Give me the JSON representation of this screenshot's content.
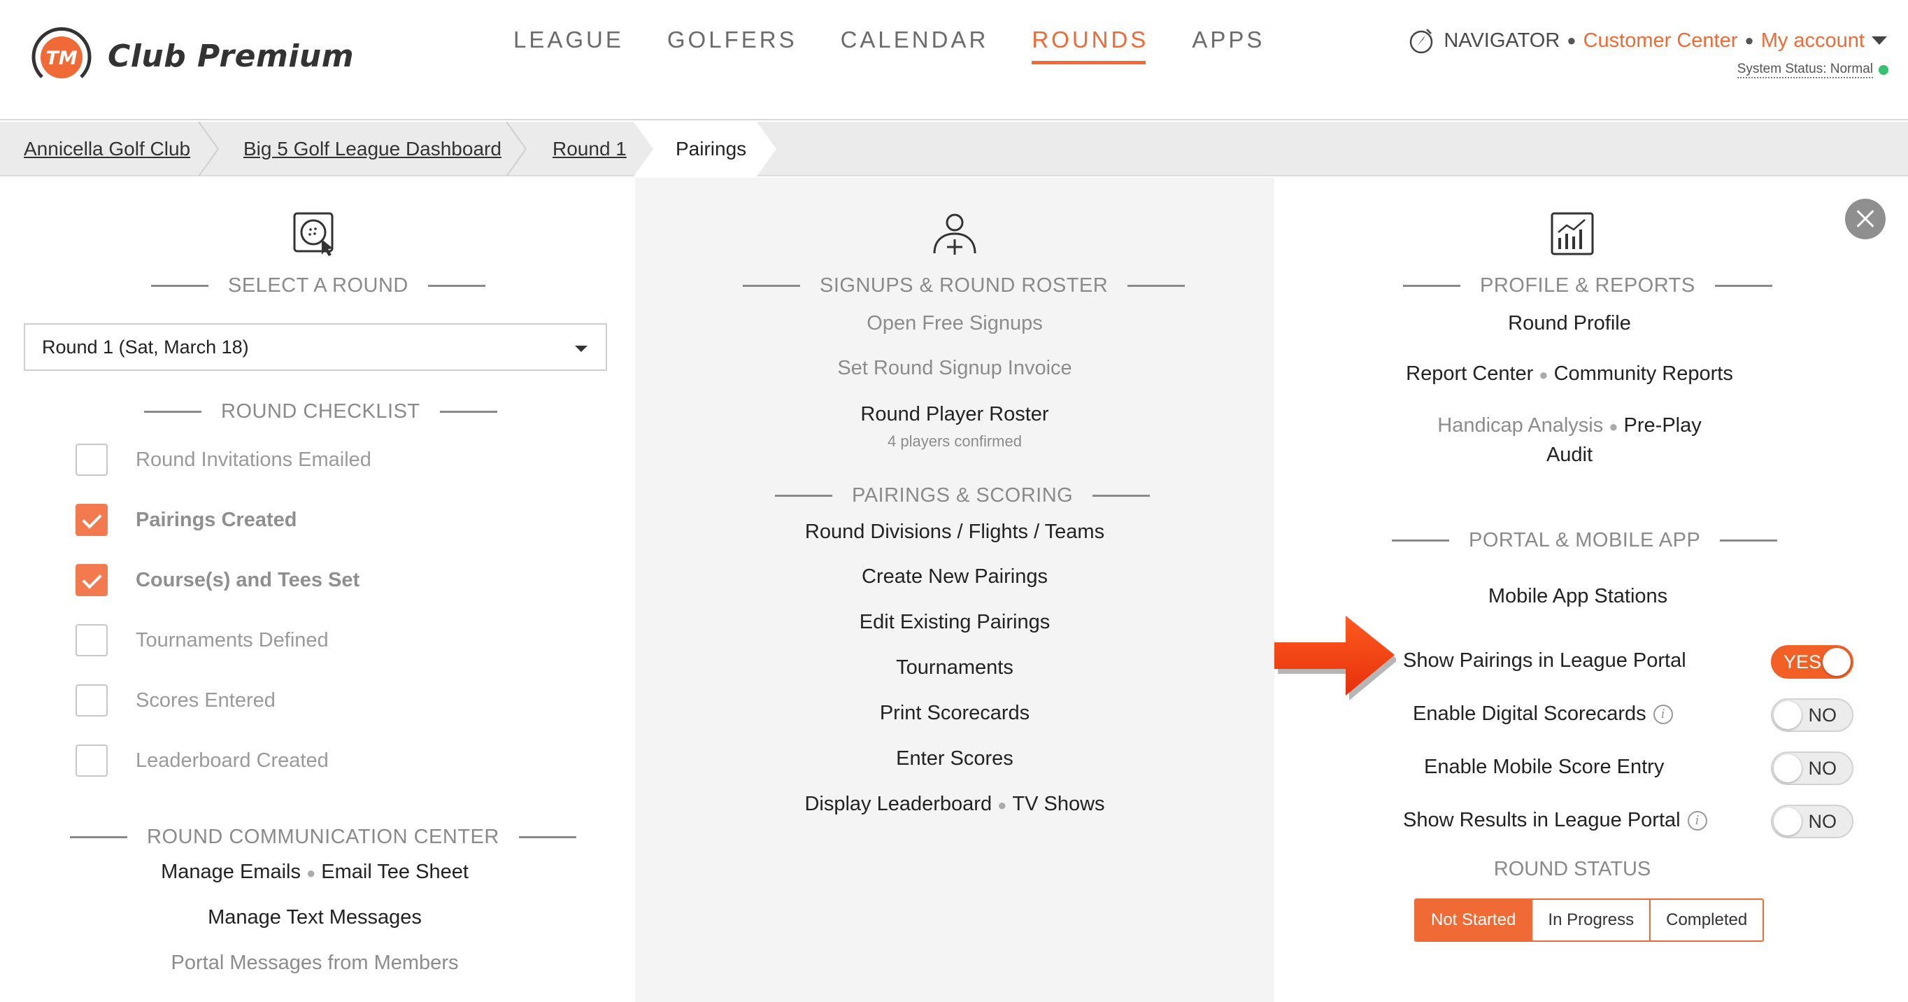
{
  "brand": {
    "name": "Club Premium",
    "mark_text": "TM",
    "accent": "#f06a35"
  },
  "nav": {
    "items": [
      {
        "label": "LEAGUE",
        "active": false
      },
      {
        "label": "GOLFERS",
        "active": false
      },
      {
        "label": "CALENDAR",
        "active": false
      },
      {
        "label": "ROUNDS",
        "active": true
      },
      {
        "label": "APPS",
        "active": false
      }
    ]
  },
  "account": {
    "navigator": "NAVIGATOR",
    "customer_center": "Customer Center",
    "my_account": "My account",
    "system_status": "System Status: Normal"
  },
  "breadcrumb": [
    {
      "label": "Annicella Golf Club"
    },
    {
      "label": "Big 5 Golf League Dashboard"
    },
    {
      "label": "Round 1"
    },
    {
      "label": "Pairings",
      "current": true
    }
  ],
  "left": {
    "select_round": {
      "heading": "SELECT A ROUND",
      "selected": "Round 1 (Sat, March 18)"
    },
    "checklist": {
      "heading": "ROUND CHECKLIST",
      "items": [
        {
          "label": "Round Invitations Emailed",
          "checked": false
        },
        {
          "label": "Pairings Created",
          "checked": true
        },
        {
          "label": "Course(s) and Tees Set",
          "checked": true
        },
        {
          "label": "Tournaments Defined",
          "checked": false
        },
        {
          "label": "Scores Entered",
          "checked": false
        },
        {
          "label": "Leaderboard Created",
          "checked": false
        }
      ]
    },
    "communication": {
      "heading": "ROUND COMMUNICATION CENTER",
      "manage_emails": "Manage Emails",
      "email_tee_sheet": "Email Tee Sheet",
      "manage_texts": "Manage Text Messages",
      "portal_messages": "Portal Messages from Members"
    }
  },
  "middle": {
    "signups": {
      "heading": "SIGNUPS & ROUND ROSTER",
      "open_free_signups": "Open Free Signups",
      "set_signup_invoice": "Set Round Signup Invoice",
      "roster": "Round Player Roster",
      "roster_sub": "4 players confirmed"
    },
    "pairings": {
      "heading": "PAIRINGS & SCORING",
      "divisions": "Round Divisions / Flights / Teams",
      "create": "Create New Pairings",
      "edit": "Edit Existing Pairings",
      "tournaments": "Tournaments",
      "print": "Print Scorecards",
      "enter_scores": "Enter Scores",
      "display_leaderboard": "Display Leaderboard",
      "tv_shows": "TV Shows"
    }
  },
  "right": {
    "profile": {
      "heading": "PROFILE & REPORTS",
      "round_profile": "Round Profile",
      "report_center": "Report Center",
      "community_reports": "Community Reports",
      "handicap_analysis": "Handicap Analysis",
      "preplay_line1": "Pre-Play",
      "preplay_line2": "Audit"
    },
    "portal": {
      "heading": "PORTAL & MOBILE APP",
      "mobile_stations": "Mobile App Stations",
      "toggles": [
        {
          "label": "Show Pairings in League Portal",
          "value": "YES",
          "on": true,
          "info": false
        },
        {
          "label": "Enable Digital Scorecards",
          "value": "NO",
          "on": false,
          "info": true
        },
        {
          "label": "Enable Mobile Score Entry",
          "value": "NO",
          "on": false,
          "info": false
        },
        {
          "label": "Show Results in League Portal",
          "value": "NO",
          "on": false,
          "info": true
        }
      ]
    },
    "status": {
      "heading": "ROUND STATUS",
      "options": [
        "Not Started",
        "In Progress",
        "Completed"
      ],
      "selected": "Not Started"
    }
  }
}
